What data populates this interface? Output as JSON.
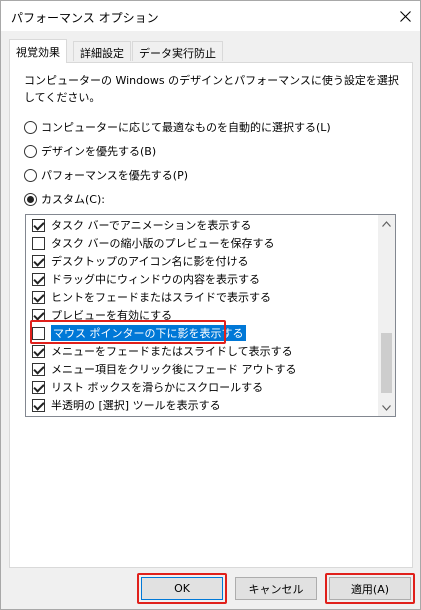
{
  "window": {
    "title": "パフォーマンス オプション"
  },
  "tabs": [
    {
      "label": "視覚効果",
      "active": true
    },
    {
      "label": "詳細設定",
      "active": false
    },
    {
      "label": "データ実行防止",
      "active": false
    }
  ],
  "description": "コンピューターの Windows のデザインとパフォーマンスに使う設定を選択してください。",
  "radios": [
    {
      "label": "コンピューターに応じて最適なものを自動的に選択する(L)",
      "checked": false
    },
    {
      "label": "デザインを優先する(B)",
      "checked": false
    },
    {
      "label": "パフォーマンスを優先する(P)",
      "checked": false
    },
    {
      "label": "カスタム(C):",
      "checked": true
    }
  ],
  "options": [
    {
      "label": "タスク バーでアニメーションを表示する",
      "checked": true
    },
    {
      "label": "タスク バーの縮小版のプレビューを保存する",
      "checked": false
    },
    {
      "label": "デスクトップのアイコン名に影を付ける",
      "checked": true
    },
    {
      "label": "ドラッグ中にウィンドウの内容を表示する",
      "checked": true
    },
    {
      "label": "ヒントをフェードまたはスライドで表示する",
      "checked": true
    },
    {
      "label": "プレビューを有効にする",
      "checked": true
    },
    {
      "label": "マウス ポインターの下に影を表示する",
      "checked": false,
      "selected": true
    },
    {
      "label": "メニューをフェードまたはスライドして表示する",
      "checked": true
    },
    {
      "label": "メニュー項目をクリック後にフェード アウトする",
      "checked": true
    },
    {
      "label": "リスト ボックスを滑らかにスクロールする",
      "checked": true
    },
    {
      "label": "半透明の [選択] ツールを表示する",
      "checked": true
    }
  ],
  "buttons": {
    "ok": "OK",
    "cancel": "キャンセル",
    "apply": "適用(A)"
  },
  "icons": {
    "close": "close-icon",
    "scroll_up": "chevron-up-icon",
    "scroll_down": "chevron-down-icon"
  },
  "colors": {
    "selection": "#0078d7",
    "highlight_box": "#e0201b"
  }
}
